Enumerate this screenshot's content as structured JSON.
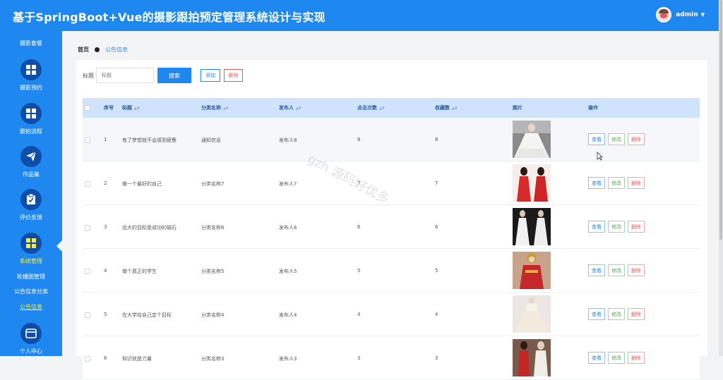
{
  "header": {
    "title": "基于SpringBoot+Vue的摄影跟拍预定管理系统设计与实现",
    "user": "admin"
  },
  "sidebar": {
    "top_label": "摄影套餐",
    "items": [
      {
        "label": "摄影预约",
        "icon": "grid-icon"
      },
      {
        "label": "跟拍流程",
        "icon": "grid-icon"
      },
      {
        "label": "作品集",
        "icon": "paper-plane-icon"
      },
      {
        "label": "评价反馈",
        "icon": "clipboard-check-icon"
      },
      {
        "label": "系统管理",
        "icon": "grid-icon",
        "active": true
      },
      {
        "label": "个人中心",
        "icon": "card-icon"
      }
    ],
    "subitems": [
      "轮播图管理",
      "公告信息分类",
      "公告信息"
    ]
  },
  "breadcrumb": {
    "home": "首页",
    "current": "公告信息"
  },
  "search": {
    "label": "标题",
    "placeholder": "标题",
    "button": "搜索",
    "add": "添加",
    "delete": "删除"
  },
  "table": {
    "columns": [
      "序号",
      "标题",
      "分类名称",
      "发布人",
      "点击次数",
      "收藏数",
      "图片",
      "操作"
    ],
    "actions": {
      "view": "查看",
      "edit": "修改",
      "delete": "删除"
    },
    "rows": [
      {
        "no": "1",
        "title": "有了梦想就不会感到疲惫",
        "category": "通知信息",
        "publisher": "发布人8",
        "clicks": "8",
        "favorites": "8"
      },
      {
        "no": "2",
        "title": "做一个最好的自己",
        "category": "分类名称7",
        "publisher": "发布人7",
        "clicks": "7",
        "favorites": "7"
      },
      {
        "no": "3",
        "title": "远大的目标是成功的磁石",
        "category": "分类名称6",
        "publisher": "发布人6",
        "clicks": "6",
        "favorites": "6"
      },
      {
        "no": "4",
        "title": "做个真正的学生",
        "category": "分类名称5",
        "publisher": "发布人5",
        "clicks": "5",
        "favorites": "5"
      },
      {
        "no": "5",
        "title": "在大学给自己定个目标",
        "category": "分类名称4",
        "publisher": "发布人4",
        "clicks": "4",
        "favorites": "4"
      },
      {
        "no": "6",
        "title": "知识就是力量",
        "category": "分类名称3",
        "publisher": "发布人3",
        "clicks": "3",
        "favorites": "3"
      }
    ]
  },
  "watermark": "gzh 源码好优多",
  "colors": {
    "primary": "#1e88f0",
    "sidebar_icon": "#0f4ea8",
    "active": "#ffeb3b",
    "danger": "#e35a5a",
    "success": "#4caf50"
  }
}
